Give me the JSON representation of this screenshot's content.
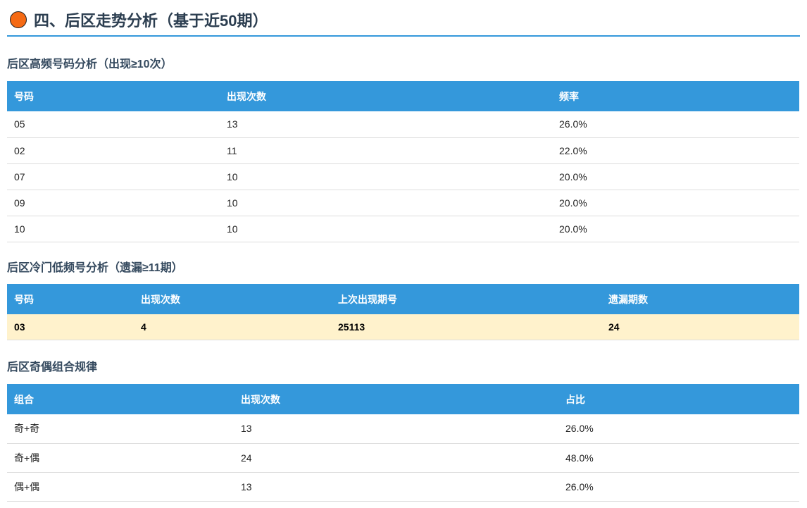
{
  "title": "四、后区走势分析（基于近50期）",
  "high": {
    "title": "后区高频号码分析（出现≥10次）",
    "headers": [
      "号码",
      "出现次数",
      "频率"
    ],
    "rows": [
      [
        "05",
        "13",
        "26.0%"
      ],
      [
        "02",
        "11",
        "22.0%"
      ],
      [
        "07",
        "10",
        "20.0%"
      ],
      [
        "09",
        "10",
        "20.0%"
      ],
      [
        "10",
        "10",
        "20.0%"
      ]
    ]
  },
  "cold": {
    "title": "后区冷门低频号分析（遗漏≥11期）",
    "headers": [
      "号码",
      "出现次数",
      "上次出现期号",
      "遗漏期数"
    ],
    "rows": [
      [
        "03",
        "4",
        "25113",
        "24"
      ]
    ]
  },
  "oddeven": {
    "title": "后区奇偶组合规律",
    "headers": [
      "组合",
      "出现次数",
      "占比"
    ],
    "rows": [
      [
        "奇+奇",
        "13",
        "26.0%"
      ],
      [
        "奇+偶",
        "24",
        "48.0%"
      ],
      [
        "偶+偶",
        "13",
        "26.0%"
      ]
    ]
  }
}
